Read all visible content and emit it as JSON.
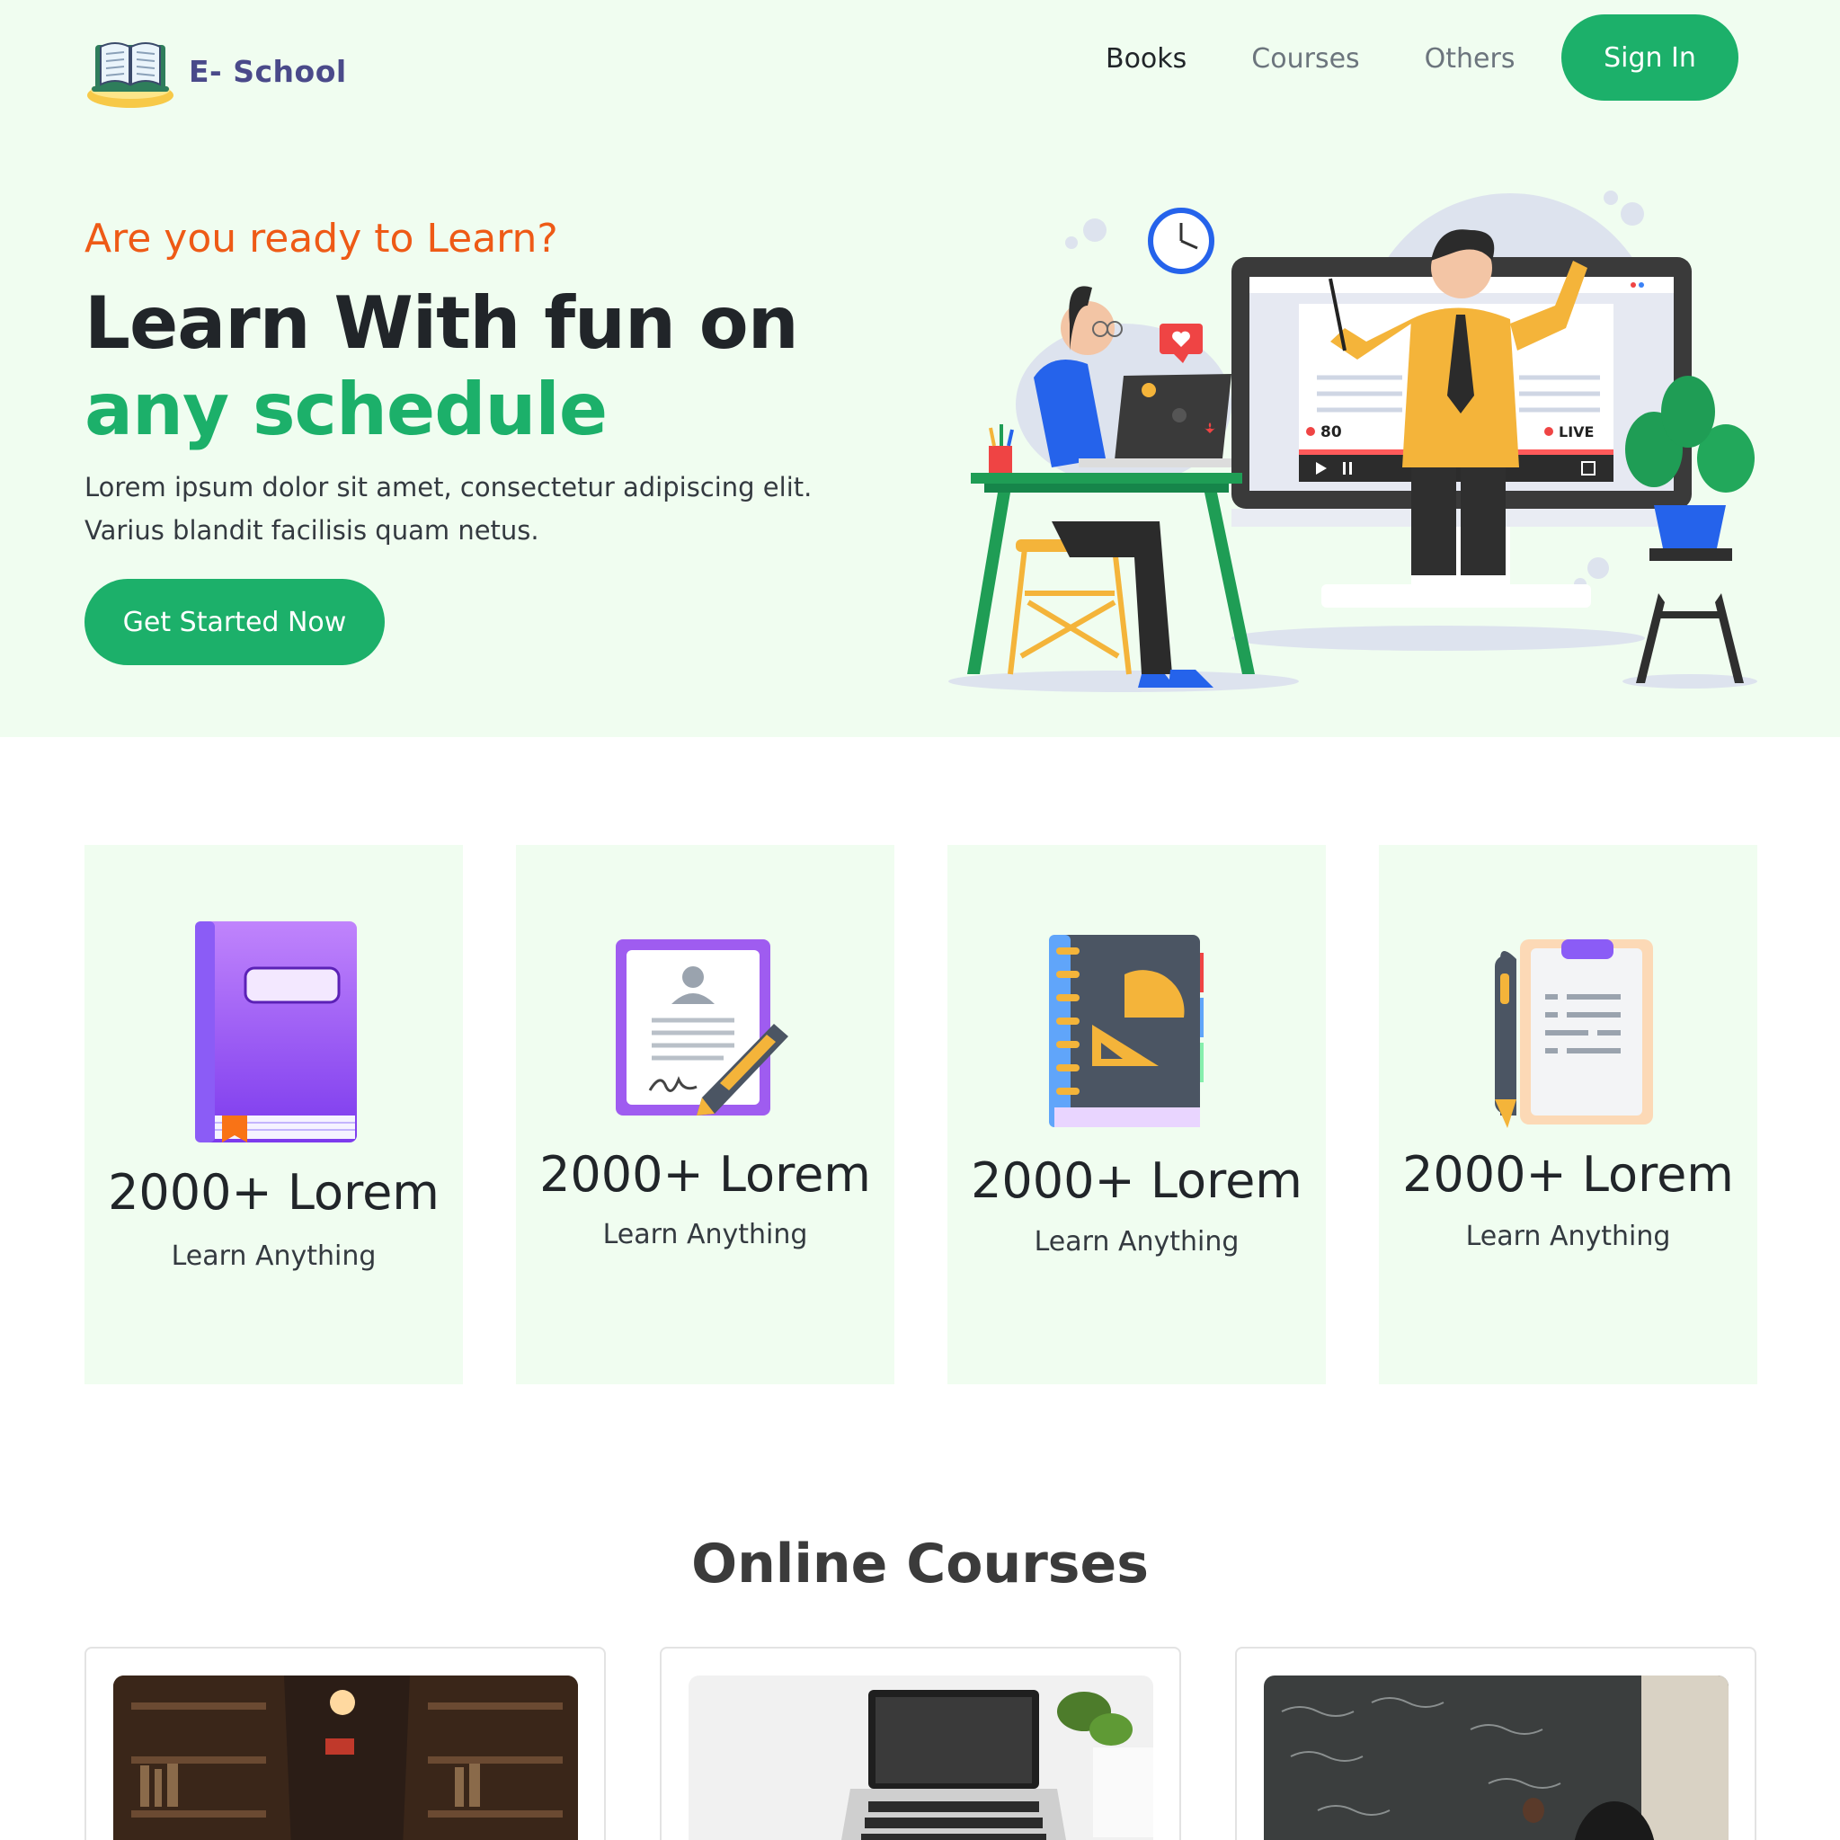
{
  "brand": {
    "name": "E- School"
  },
  "nav": {
    "items": [
      "Books",
      "Courses",
      "Others"
    ],
    "active": "Books",
    "signin_label": "Sign In"
  },
  "hero": {
    "eyebrow": "Are you ready to Learn?",
    "title_part1": "Learn With fun on ",
    "title_highlight": "any schedule",
    "description": "Lorem ipsum dolor sit amet, consectetur adipiscing elit. Varius blandit facilisis quam netus.",
    "cta_label": "Get Started Now",
    "illustration": {
      "viewers": "80",
      "live_label": "LIVE"
    }
  },
  "features": [
    {
      "icon": "book-icon",
      "title": "2000+ Lorem",
      "subtitle": "Learn Anything"
    },
    {
      "icon": "certificate-icon",
      "title": "2000+ Lorem",
      "subtitle": "Learn Anything"
    },
    {
      "icon": "notebook-ruler-icon",
      "title": "2000+ Lorem",
      "subtitle": "Learn Anything"
    },
    {
      "icon": "clipboard-pen-icon",
      "title": "2000+ Lorem",
      "subtitle": "Learn Anything"
    }
  ],
  "courses": {
    "title": "Online Courses",
    "items": [
      {
        "image": "library-photo"
      },
      {
        "image": "laptop-desk-photo"
      },
      {
        "image": "chalkboard-photo"
      }
    ]
  },
  "colors": {
    "brand_green": "#1cb06a",
    "hero_bg": "#f0fdf0",
    "accent_orange": "#ee5a16",
    "logo_text": "#4a4a8a"
  }
}
